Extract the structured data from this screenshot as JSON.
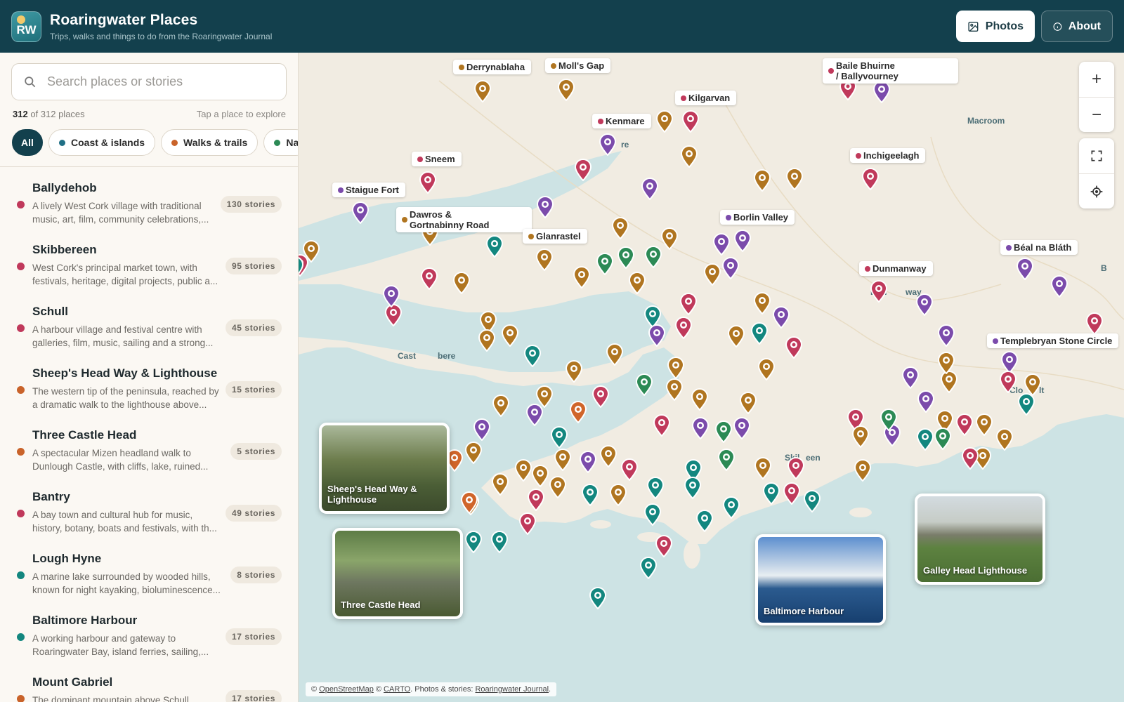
{
  "header": {
    "logo_text": "RW",
    "title": "Roaringwater Places",
    "subtitle": "Trips, walks and things to do from the Roaringwater Journal",
    "photos_label": "Photos",
    "about_label": "About"
  },
  "sidebar": {
    "search_placeholder": "Search places or stories",
    "count_shown": "312",
    "count_rest": " of 312 places",
    "hint": "Tap a place to explore",
    "chips": [
      {
        "label": "All"
      },
      {
        "label": "Coast & islands",
        "color": "#1f6f85"
      },
      {
        "label": "Walks & trails",
        "color": "#c9632a"
      },
      {
        "label": "Na",
        "color": "#2c8a55"
      }
    ],
    "places": [
      {
        "name": "Ballydehob",
        "desc": "A lively West Cork village with traditional music, art, film, community celebrations,...",
        "stories": "130 stories",
        "color": "#c0395b"
      },
      {
        "name": "Skibbereen",
        "desc": "West Cork's principal market town, with festivals, heritage, digital projects, public a...",
        "stories": "95 stories",
        "color": "#c0395b"
      },
      {
        "name": "Schull",
        "desc": "A harbour village and festival centre with galleries, film, music, sailing and a strong...",
        "stories": "45 stories",
        "color": "#c0395b"
      },
      {
        "name": "Sheep's Head Way & Lighthouse",
        "desc": "The western tip of the peninsula, reached by a dramatic walk to the lighthouse above...",
        "stories": "15 stories",
        "color": "#c9632a"
      },
      {
        "name": "Three Castle Head",
        "desc": "A spectacular Mizen headland walk to Dunlough Castle, with cliffs, lake, ruined...",
        "stories": "5 stories",
        "color": "#c9632a"
      },
      {
        "name": "Bantry",
        "desc": "A bay town and cultural hub for music, history, botany, boats and festivals, with th...",
        "stories": "49 stories",
        "color": "#c0395b"
      },
      {
        "name": "Lough Hyne",
        "desc": "A marine lake surrounded by wooded hills, known for night kayaking, bioluminescence...",
        "stories": "8 stories",
        "color": "#13877f"
      },
      {
        "name": "Baltimore Harbour",
        "desc": "A working harbour and gateway to Roaringwater Bay, island ferries, sailing,...",
        "stories": "17 stories",
        "color": "#13877f"
      },
      {
        "name": "Mount Gabriel",
        "desc": "The dominant mountain above Schull",
        "stories": "17 stories",
        "color": "#c9632a"
      }
    ]
  },
  "map": {
    "labels": [
      {
        "text": "Derrynablaha",
        "color": "#b07520"
      },
      {
        "text": "Moll's Gap",
        "color": "#b07520"
      },
      {
        "text": "Baile Bhuirne\n/ Ballyvourney",
        "color": "#c0395b"
      },
      {
        "text": "Kilgarvan",
        "color": "#c0395b"
      },
      {
        "text": "Kenmare",
        "color": "#c0395b"
      },
      {
        "text": "Sneem",
        "color": "#c0395b"
      },
      {
        "text": "Inchigeelagh",
        "color": "#c0395b"
      },
      {
        "text": "Staigue Fort",
        "color": "#7b4bab"
      },
      {
        "text": "Dawros &\nGortnabinny Road",
        "color": "#b07520"
      },
      {
        "text": "Glanrastel",
        "color": "#b07520"
      },
      {
        "text": "Borlin Valley",
        "color": "#7b4bab"
      },
      {
        "text": "Béal na Bláth",
        "color": "#7b4bab"
      },
      {
        "text": "Dunmanway",
        "color": "#c0395b"
      },
      {
        "text": "Templebryan Stone Circle",
        "color": "#7b4bab"
      }
    ],
    "towns": [
      "Macroom",
      "Ke",
      "re",
      "Dun",
      "way",
      "Cast",
      "bere",
      "B",
      "Clo",
      "lt",
      "Skil",
      "een"
    ],
    "photos": [
      {
        "caption": "Sheep's Head Way &\nLighthouse"
      },
      {
        "caption": "Three Castle Head"
      },
      {
        "caption": "Baltimore Harbour"
      },
      {
        "caption": "Galley Head Lighthouse"
      }
    ],
    "zoom_in": "+",
    "zoom_out": "−",
    "attribution": {
      "prefix": "© ",
      "osm": "OpenStreetMap",
      "mid": " © ",
      "carto": "CARTO",
      "text": ". Photos & stories: ",
      "rwj": "Roaringwater Journal",
      "end": "."
    },
    "pin_colors": {
      "red": "#c0395b",
      "gold": "#b07520",
      "orange": "#d0652a",
      "purple": "#7b4bab",
      "teal": "#13877f",
      "blue": "#1f6f85",
      "green": "#2c8a55"
    }
  }
}
